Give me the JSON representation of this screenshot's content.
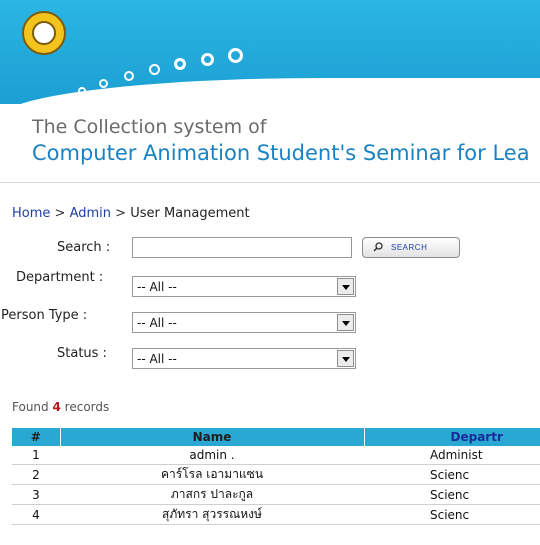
{
  "header": {
    "title_line1": "The Collection system of",
    "title_line2": "Computer Animation Student's Seminar for Lea"
  },
  "breadcrumb": {
    "home": "Home",
    "sep1": ">",
    "admin": "Admin",
    "sep2": ">",
    "current": "User Management"
  },
  "form": {
    "search_label": "Search :",
    "search_value": "",
    "search_button_label": "SEARCH",
    "department_label": "Department :",
    "department_value": "-- All --",
    "person_type_label": "Person Type :",
    "person_type_value": "-- All --",
    "status_label": "Status :",
    "status_value": "-- All --"
  },
  "results": {
    "prefix": "Found",
    "count": "4",
    "suffix": "records"
  },
  "table": {
    "headers": [
      "#",
      "Name",
      "Departr"
    ],
    "rows": [
      [
        "1",
        "admin .",
        "Administ"
      ],
      [
        "2",
        "คาร์โรล เอามาแซน",
        "Scienc"
      ],
      [
        "3",
        "ภาสกร ปาละกูล",
        "Scienc"
      ],
      [
        "4",
        "สุภัทรา สุวรรณหงษ์",
        "Scienc"
      ]
    ]
  },
  "colors": {
    "header_bg": "#22a9da",
    "table_header_bg": "#2aa8d4",
    "link": "#1f3fa8",
    "title_blue": "#1a82c2",
    "count_red": "#c0131a"
  }
}
